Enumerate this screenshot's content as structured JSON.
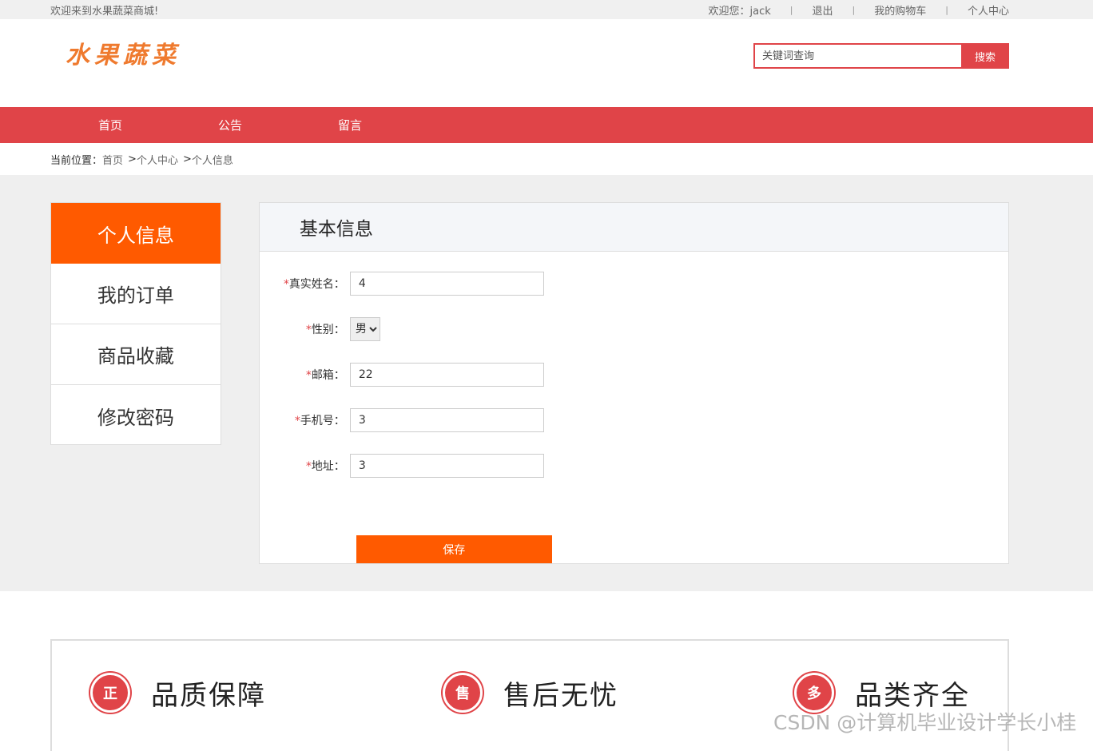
{
  "topbar": {
    "welcome_site": "欢迎来到水果蔬菜商城!",
    "welcome_user": "欢迎您：jack",
    "logout": "退出",
    "cart": "我的购物车",
    "center": "个人中心",
    "sep": "|"
  },
  "header": {
    "logo_text": "水果蔬菜",
    "search_placeholder": "关键词查询",
    "search_button": "搜索"
  },
  "nav": {
    "items": [
      "首页",
      "公告",
      "留言"
    ]
  },
  "breadcrumb": {
    "label": "当前位置：",
    "home": "首页",
    "level1": "个人中心",
    "level2": "个人信息",
    "gt": ">"
  },
  "sidebar": {
    "items": [
      "个人信息",
      "我的订单",
      "商品收藏",
      "修改密码"
    ]
  },
  "form": {
    "title": "基本信息",
    "required_mark": "*",
    "name_label": "真实姓名：",
    "name_value": "4",
    "gender_label": "性别：",
    "gender_value": "男",
    "email_label": "邮箱：",
    "email_value": "22",
    "phone_label": "手机号：",
    "phone_value": "3",
    "address_label": "地址：",
    "address_value": "3",
    "save_button": "保存"
  },
  "features": {
    "items": [
      {
        "icon_char": "正",
        "title": "品质保障"
      },
      {
        "icon_char": "售",
        "title": "售后无忧"
      },
      {
        "icon_char": "多",
        "title": "品类齐全"
      }
    ]
  },
  "watermark": "CSDN @计算机毕业设计学长小桂",
  "colors": {
    "accent_red": "#e04448",
    "accent_orange": "#ff5a00"
  }
}
